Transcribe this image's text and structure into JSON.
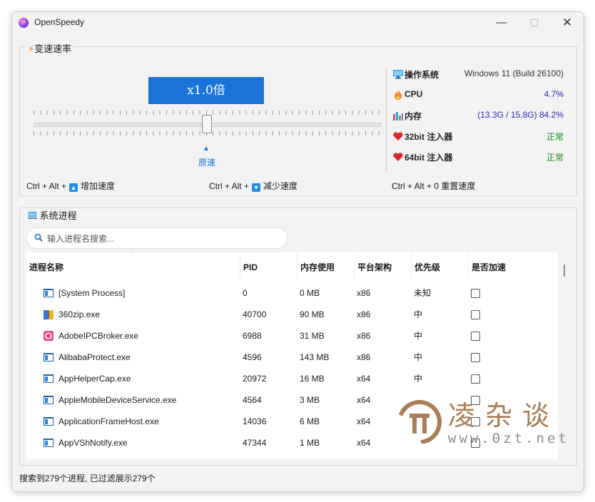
{
  "window": {
    "title": "OpenSpeedy"
  },
  "speed_group": {
    "legend": "变速速率",
    "display": "x1.0倍",
    "origin_label": "原速",
    "speed_factor": 1.0
  },
  "system_info": [
    {
      "icon": "monitor-icon",
      "label": "操作系统",
      "value": "Windows 11 (Build 26100)",
      "color": "#333333"
    },
    {
      "icon": "flame-icon",
      "label": "CPU",
      "value": "4.7%",
      "color": "#2a2ab8"
    },
    {
      "icon": "memory-chart-icon",
      "label": "内存",
      "value": "(13.3G / 15.8G) 84.2%",
      "color": "#2a2ab8"
    },
    {
      "icon": "heart-icon",
      "label": "32bit 注入器",
      "value": "正常",
      "color": "#1a8a1a"
    },
    {
      "icon": "heart-icon",
      "label": "64bit 注入器",
      "value": "正常",
      "color": "#1a8a1a"
    }
  ],
  "hotkeys": {
    "increase_prefix": "Ctrl + Alt +",
    "increase_label": "增加速度",
    "decrease_prefix": "Ctrl + Alt +",
    "decrease_label": "减少速度",
    "reset_text": "Ctrl + Alt + 0 重置速度"
  },
  "process_group": {
    "legend": "系统进程",
    "search_placeholder": "输入进程名搜索...",
    "columns": [
      "进程名称",
      "PID",
      "内存使用",
      "平台架构",
      "优先级",
      "是否加速"
    ],
    "rows": [
      {
        "icon": "window-app-icon",
        "name": "[System Process]",
        "pid": "0",
        "memory": "0 MB",
        "arch": "x86",
        "priority": "未知"
      },
      {
        "icon": "zip-archive-icon",
        "name": "360zip.exe",
        "pid": "40700",
        "memory": "90 MB",
        "arch": "x86",
        "priority": "中"
      },
      {
        "icon": "adobe-app-icon",
        "name": "AdobeIPCBroker.exe",
        "pid": "6988",
        "memory": "31 MB",
        "arch": "x86",
        "priority": "中"
      },
      {
        "icon": "window-app-icon",
        "name": "AlibabaProtect.exe",
        "pid": "4596",
        "memory": "143 MB",
        "arch": "x86",
        "priority": "中"
      },
      {
        "icon": "window-app-icon",
        "name": "AppHelperCap.exe",
        "pid": "20972",
        "memory": "16 MB",
        "arch": "x64",
        "priority": "中"
      },
      {
        "icon": "window-app-icon",
        "name": "AppleMobileDeviceService.exe",
        "pid": "4564",
        "memory": "3 MB",
        "arch": "x64",
        "priority": ""
      },
      {
        "icon": "window-app-icon",
        "name": "ApplicationFrameHost.exe",
        "pid": "14036",
        "memory": "6 MB",
        "arch": "x64",
        "priority": ""
      },
      {
        "icon": "window-app-icon",
        "name": "AppVShNotify.exe",
        "pid": "47344",
        "memory": "1 MB",
        "arch": "x64",
        "priority": ""
      }
    ]
  },
  "status": {
    "text": "搜索到279个进程, 已过滤展示279个"
  },
  "watermark": {
    "cn": "凌杂谈",
    "url": "www.0zt.net"
  }
}
